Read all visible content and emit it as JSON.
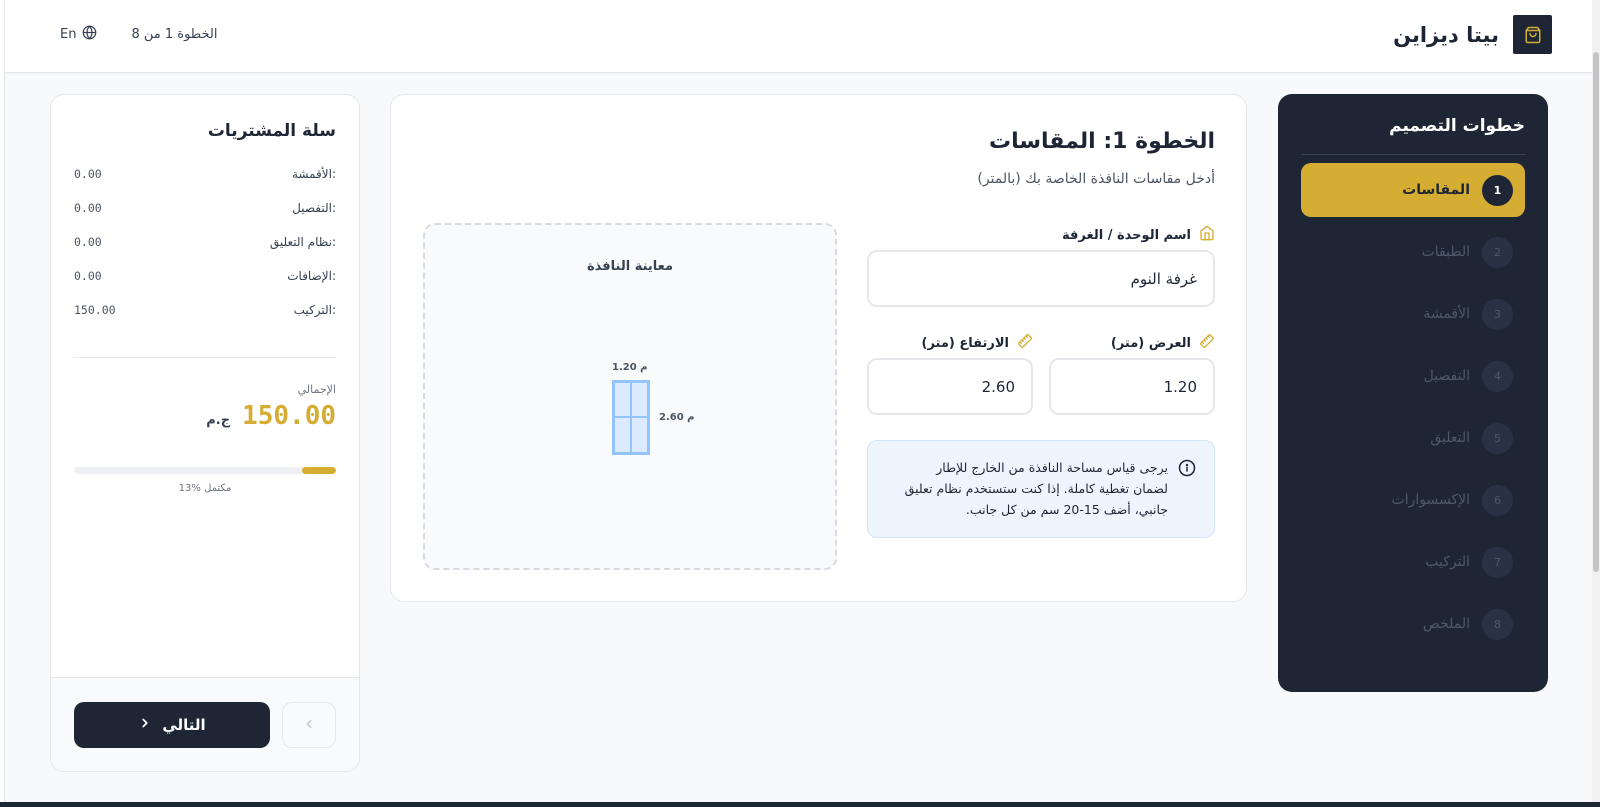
{
  "header": {
    "brand_name": "بيتا ديزاين",
    "brand_icon": "shopping-bag-icon",
    "step_indicator": "الخطوة 1 من 8",
    "language": "En",
    "language_icon": "globe-icon"
  },
  "steps_panel": {
    "title": "خطوات التصميم",
    "active_color": "#d6ad33",
    "items": [
      {
        "num": "1",
        "label": "المقاسات",
        "active": true
      },
      {
        "num": "2",
        "label": "الطبقات",
        "active": false
      },
      {
        "num": "3",
        "label": "الأقمشة",
        "active": false
      },
      {
        "num": "4",
        "label": "التفصيل",
        "active": false
      },
      {
        "num": "5",
        "label": "التعليق",
        "active": false
      },
      {
        "num": "6",
        "label": "الإكسسوارات",
        "active": false
      },
      {
        "num": "7",
        "label": "التركيب",
        "active": false
      },
      {
        "num": "8",
        "label": "الملخص",
        "active": false
      }
    ]
  },
  "main": {
    "title": "الخطوة 1: المقاسات",
    "subtitle": "أدخل مقاسات النافذة الخاصة بك (بالمتر)",
    "room": {
      "label": "اسم الوحدة / الغرفة",
      "icon": "home-icon",
      "value": "غرفة النوم"
    },
    "width": {
      "label": "العرض (متر)",
      "icon": "ruler-icon",
      "value": "1.20"
    },
    "height": {
      "label": "الارتفاع (متر)",
      "icon": "ruler-icon",
      "value": "2.60"
    },
    "info": {
      "icon": "info-icon",
      "text": "يرجى قياس مساحة النافذة من الخارج للإطار لضمان تغطية كاملة. إذا كنت ستستخدم نظام تعليق جانبي، أضف 15-20 سم من كل جانب."
    },
    "preview": {
      "title": "معاينة النافذة",
      "width_label": "1.20 م",
      "height_label": "2.60 م"
    }
  },
  "cart": {
    "title": "سلة المشتريات",
    "rows": [
      {
        "label": "الأقمشة:",
        "value": "0.00"
      },
      {
        "label": "التفصيل:",
        "value": "0.00"
      },
      {
        "label": "نظام التعليق:",
        "value": "0.00"
      },
      {
        "label": "الإضافات:",
        "value": "0.00"
      },
      {
        "label": "التركيب:",
        "value": "150.00"
      }
    ],
    "total_label": "الإجمالي",
    "total_value": "150.00",
    "currency": "ج.م",
    "progress_percent": 13,
    "progress_text": "13% مكتمل",
    "next_label": "التالي",
    "next_icon": "chevron-right-icon",
    "prev_icon": "chevron-left-icon"
  }
}
